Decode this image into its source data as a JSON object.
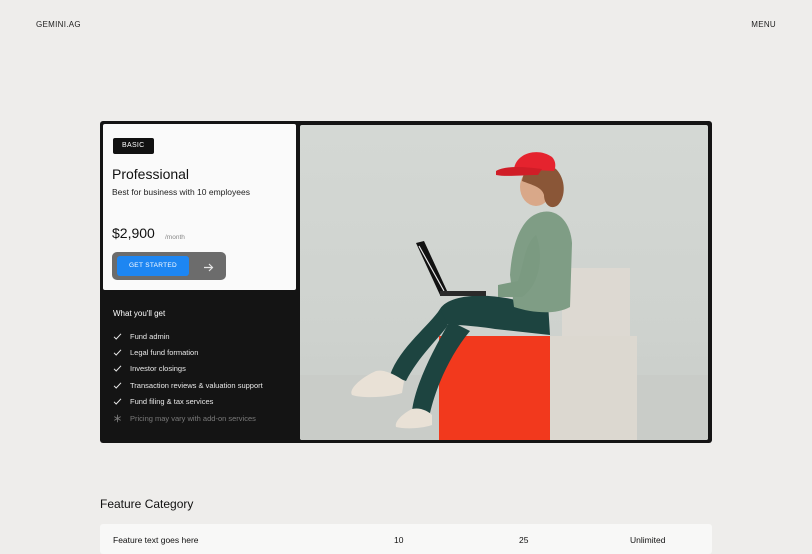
{
  "header": {
    "brand": "GEMINI.AG",
    "menu_label": "MENU"
  },
  "plan": {
    "badge": "BASIC",
    "title": "Professional",
    "subtitle": "Best for business with 10 employees",
    "price": "$2,900",
    "price_unit": "/month",
    "cta_label": "GET STARTED"
  },
  "features": {
    "title": "What you'll get",
    "items": [
      "Fund admin",
      "Legal fund formation",
      "Investor closings",
      "Transaction reviews & valuation support",
      "Fund filing & tax services"
    ],
    "note": "Pricing may vary with add-on services"
  },
  "table": {
    "section_title": "Feature Category",
    "row": {
      "label": "Feature text goes here",
      "col1": "10",
      "col2": "25",
      "col3": "Unlimited"
    }
  },
  "colors": {
    "accent": "#1d86f2",
    "card_bg": "#141414",
    "page_bg": "#eeedeb"
  }
}
